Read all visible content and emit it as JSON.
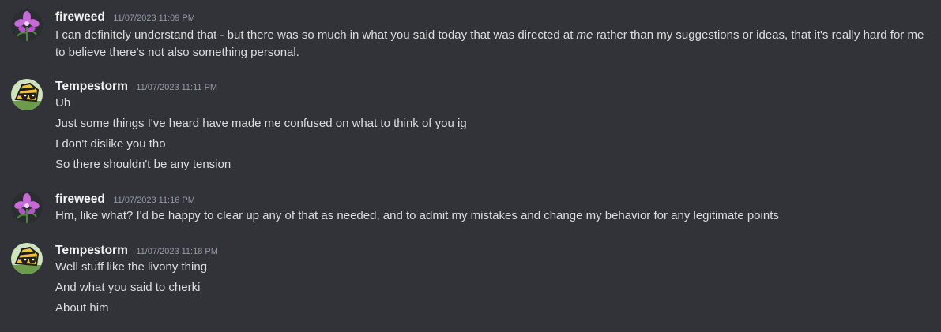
{
  "messages": [
    {
      "username": "fireweed",
      "timestamp": "11/07/2023 11:09 PM",
      "avatar_icon": "fireweed-flower-icon",
      "lines": [
        {
          "before": "I can definitely understand that - but there was so much in what you said today that was directed at ",
          "emphasis": "me",
          "after": " rather than my suggestions or ideas, that it's really hard for me to believe there's not also something personal."
        }
      ]
    },
    {
      "username": "Tempestorm",
      "timestamp": "11/07/2023 11:11 PM",
      "avatar_icon": "tempestorm-avatar-icon",
      "lines": [
        "Uh",
        "Just some things I've heard have made me confused on what to think of you ig",
        "I don't dislike you tho",
        "So there shouldn't be any tension"
      ]
    },
    {
      "username": "fireweed",
      "timestamp": "11/07/2023 11:16 PM",
      "avatar_icon": "fireweed-flower-icon",
      "lines": [
        "Hm, like what? I'd be happy to clear up any of that as needed, and to admit my mistakes and change my behavior for any legitimate points"
      ]
    },
    {
      "username": "Tempestorm",
      "timestamp": "11/07/2023 11:18 PM",
      "avatar_icon": "tempestorm-avatar-icon",
      "lines": [
        "Well stuff like the livony thing",
        "And what you said to cherki",
        "About him"
      ]
    }
  ],
  "colors": {
    "background": "#313338",
    "username": "#f2f3f5",
    "timestamp": "#949ba4",
    "text": "#dbdee1"
  }
}
